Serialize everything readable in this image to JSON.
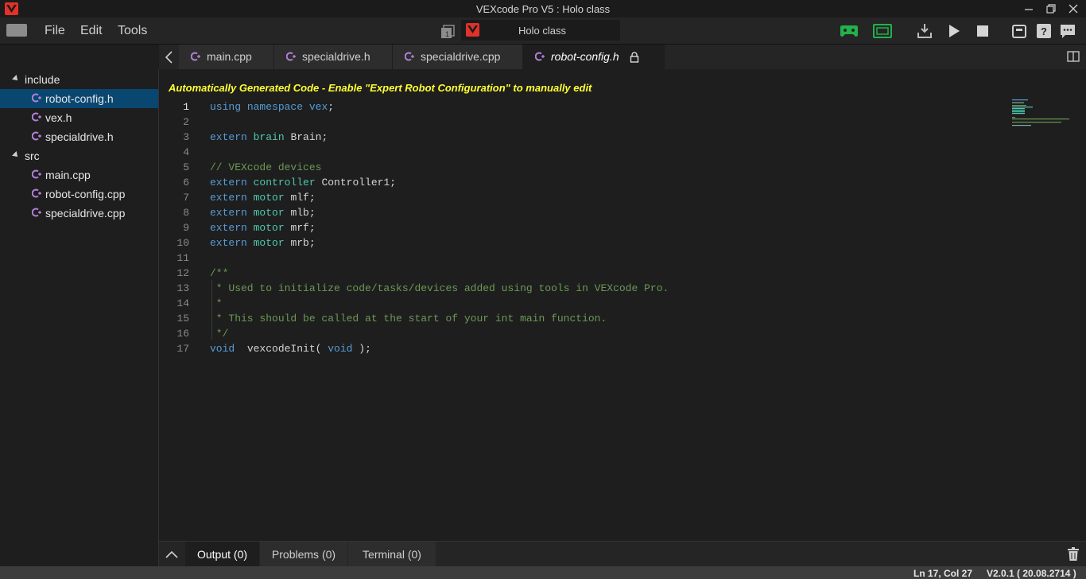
{
  "window": {
    "title": "VEXcode Pro V5 : Holo class"
  },
  "menu": {
    "items": [
      "File",
      "Edit",
      "Tools"
    ]
  },
  "project": {
    "name": "Holo class"
  },
  "colors": {
    "accent": "#e0322a",
    "selection": "#094771",
    "notice": "#ffff33",
    "controller_green": "#22b14c"
  },
  "toolbar": {
    "icons": [
      "controller-icon",
      "brain-screen-icon",
      "download-icon",
      "play-icon",
      "stop-icon",
      "device-info-icon",
      "help-icon",
      "feedback-icon"
    ]
  },
  "explorer": {
    "folders": [
      {
        "name": "include",
        "files": [
          "robot-config.h",
          "vex.h",
          "specialdrive.h"
        ]
      },
      {
        "name": "src",
        "files": [
          "main.cpp",
          "robot-config.cpp",
          "specialdrive.cpp"
        ]
      }
    ],
    "selected": "robot-config.h"
  },
  "tabs": [
    {
      "label": "main.cpp"
    },
    {
      "label": "specialdrive.h"
    },
    {
      "label": "specialdrive.cpp"
    },
    {
      "label": "robot-config.h"
    }
  ],
  "editor": {
    "notice": "Automatically Generated Code - Enable \"Expert Robot Configuration\" to manually edit",
    "line_numbers": [
      "1",
      "2",
      "3",
      "4",
      "5",
      "6",
      "7",
      "8",
      "9",
      "10",
      "11",
      "12",
      "13",
      "14",
      "15",
      "16",
      "17"
    ]
  },
  "bottom_panel": {
    "tabs": [
      "Output (0)",
      "Problems (0)",
      "Terminal (0)"
    ]
  },
  "status": {
    "position": "Ln 17, Col 27",
    "version": "V2.0.1 ( 20.08.2714 )"
  }
}
